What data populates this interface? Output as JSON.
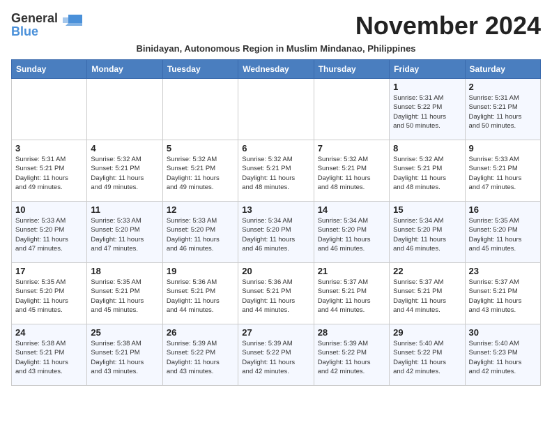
{
  "header": {
    "logo_general": "General",
    "logo_blue": "Blue",
    "month_title": "November 2024",
    "subtitle": "Binidayan, Autonomous Region in Muslim Mindanao, Philippines"
  },
  "weekdays": [
    "Sunday",
    "Monday",
    "Tuesday",
    "Wednesday",
    "Thursday",
    "Friday",
    "Saturday"
  ],
  "weeks": [
    [
      {
        "day": "",
        "info": ""
      },
      {
        "day": "",
        "info": ""
      },
      {
        "day": "",
        "info": ""
      },
      {
        "day": "",
        "info": ""
      },
      {
        "day": "",
        "info": ""
      },
      {
        "day": "1",
        "info": "Sunrise: 5:31 AM\nSunset: 5:22 PM\nDaylight: 11 hours\nand 50 minutes."
      },
      {
        "day": "2",
        "info": "Sunrise: 5:31 AM\nSunset: 5:21 PM\nDaylight: 11 hours\nand 50 minutes."
      }
    ],
    [
      {
        "day": "3",
        "info": "Sunrise: 5:31 AM\nSunset: 5:21 PM\nDaylight: 11 hours\nand 49 minutes."
      },
      {
        "day": "4",
        "info": "Sunrise: 5:32 AM\nSunset: 5:21 PM\nDaylight: 11 hours\nand 49 minutes."
      },
      {
        "day": "5",
        "info": "Sunrise: 5:32 AM\nSunset: 5:21 PM\nDaylight: 11 hours\nand 49 minutes."
      },
      {
        "day": "6",
        "info": "Sunrise: 5:32 AM\nSunset: 5:21 PM\nDaylight: 11 hours\nand 48 minutes."
      },
      {
        "day": "7",
        "info": "Sunrise: 5:32 AM\nSunset: 5:21 PM\nDaylight: 11 hours\nand 48 minutes."
      },
      {
        "day": "8",
        "info": "Sunrise: 5:32 AM\nSunset: 5:21 PM\nDaylight: 11 hours\nand 48 minutes."
      },
      {
        "day": "9",
        "info": "Sunrise: 5:33 AM\nSunset: 5:21 PM\nDaylight: 11 hours\nand 47 minutes."
      }
    ],
    [
      {
        "day": "10",
        "info": "Sunrise: 5:33 AM\nSunset: 5:20 PM\nDaylight: 11 hours\nand 47 minutes."
      },
      {
        "day": "11",
        "info": "Sunrise: 5:33 AM\nSunset: 5:20 PM\nDaylight: 11 hours\nand 47 minutes."
      },
      {
        "day": "12",
        "info": "Sunrise: 5:33 AM\nSunset: 5:20 PM\nDaylight: 11 hours\nand 46 minutes."
      },
      {
        "day": "13",
        "info": "Sunrise: 5:34 AM\nSunset: 5:20 PM\nDaylight: 11 hours\nand 46 minutes."
      },
      {
        "day": "14",
        "info": "Sunrise: 5:34 AM\nSunset: 5:20 PM\nDaylight: 11 hours\nand 46 minutes."
      },
      {
        "day": "15",
        "info": "Sunrise: 5:34 AM\nSunset: 5:20 PM\nDaylight: 11 hours\nand 46 minutes."
      },
      {
        "day": "16",
        "info": "Sunrise: 5:35 AM\nSunset: 5:20 PM\nDaylight: 11 hours\nand 45 minutes."
      }
    ],
    [
      {
        "day": "17",
        "info": "Sunrise: 5:35 AM\nSunset: 5:20 PM\nDaylight: 11 hours\nand 45 minutes."
      },
      {
        "day": "18",
        "info": "Sunrise: 5:35 AM\nSunset: 5:21 PM\nDaylight: 11 hours\nand 45 minutes."
      },
      {
        "day": "19",
        "info": "Sunrise: 5:36 AM\nSunset: 5:21 PM\nDaylight: 11 hours\nand 44 minutes."
      },
      {
        "day": "20",
        "info": "Sunrise: 5:36 AM\nSunset: 5:21 PM\nDaylight: 11 hours\nand 44 minutes."
      },
      {
        "day": "21",
        "info": "Sunrise: 5:37 AM\nSunset: 5:21 PM\nDaylight: 11 hours\nand 44 minutes."
      },
      {
        "day": "22",
        "info": "Sunrise: 5:37 AM\nSunset: 5:21 PM\nDaylight: 11 hours\nand 44 minutes."
      },
      {
        "day": "23",
        "info": "Sunrise: 5:37 AM\nSunset: 5:21 PM\nDaylight: 11 hours\nand 43 minutes."
      }
    ],
    [
      {
        "day": "24",
        "info": "Sunrise: 5:38 AM\nSunset: 5:21 PM\nDaylight: 11 hours\nand 43 minutes."
      },
      {
        "day": "25",
        "info": "Sunrise: 5:38 AM\nSunset: 5:21 PM\nDaylight: 11 hours\nand 43 minutes."
      },
      {
        "day": "26",
        "info": "Sunrise: 5:39 AM\nSunset: 5:22 PM\nDaylight: 11 hours\nand 43 minutes."
      },
      {
        "day": "27",
        "info": "Sunrise: 5:39 AM\nSunset: 5:22 PM\nDaylight: 11 hours\nand 42 minutes."
      },
      {
        "day": "28",
        "info": "Sunrise: 5:39 AM\nSunset: 5:22 PM\nDaylight: 11 hours\nand 42 minutes."
      },
      {
        "day": "29",
        "info": "Sunrise: 5:40 AM\nSunset: 5:22 PM\nDaylight: 11 hours\nand 42 minutes."
      },
      {
        "day": "30",
        "info": "Sunrise: 5:40 AM\nSunset: 5:23 PM\nDaylight: 11 hours\nand 42 minutes."
      }
    ]
  ]
}
